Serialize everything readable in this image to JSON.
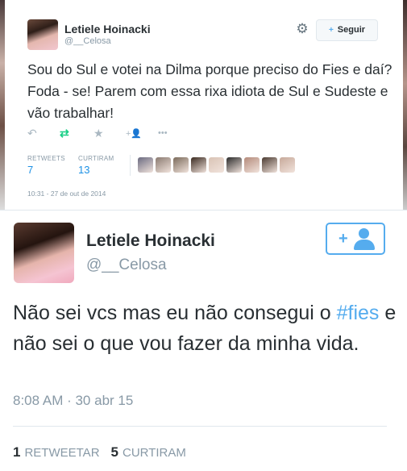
{
  "tweet1": {
    "name": "Letiele Hoinacki",
    "handle": "@__Celosa",
    "follow_label": "Seguir",
    "follow_icon": "+",
    "gear_icon": "⚙",
    "text": "Sou do Sul e votei na Dilma porque preciso do Fies e daí? Foda - se! Parem com essa rixa idiota de Sul e Sudeste e vão trabalhar!",
    "actions": {
      "reply_icon": "↶",
      "retweet_icon": "⇄",
      "favorite_icon": "★",
      "follow_icon": "+👤",
      "more_icon": "•••"
    },
    "retweets_label": "RETWEETS",
    "retweets_value": "7",
    "likes_label": "CURTIRAM",
    "likes_value": "13",
    "timestamp": "10:31 - 27 de out de 2014",
    "favoriters_colors": [
      "#6a6a80",
      "#8a7a70",
      "#7a6a5a",
      "#3a2a20",
      "#d9c3b5",
      "#2b2b2b",
      "#b48a7a",
      "#4a3a30",
      "#c7a99a"
    ]
  },
  "tweet2": {
    "name": "Letiele Hoinacki",
    "handle": "@__Celosa",
    "text_before": "Não sei vcs mas eu não consegui o ",
    "hashtag": "#fies",
    "text_after": " e não sei o que vou fazer da minha vida.",
    "timestamp": "8:08 AM · 30 abr 15",
    "retweets_count": "1",
    "retweets_label": "RETWEETAR",
    "likes_count": "5",
    "likes_label": "CURTIRAM"
  },
  "colors": {
    "accent": "#55acee",
    "link": "#1d91e5",
    "muted": "#8899a6",
    "text": "#292f33"
  }
}
